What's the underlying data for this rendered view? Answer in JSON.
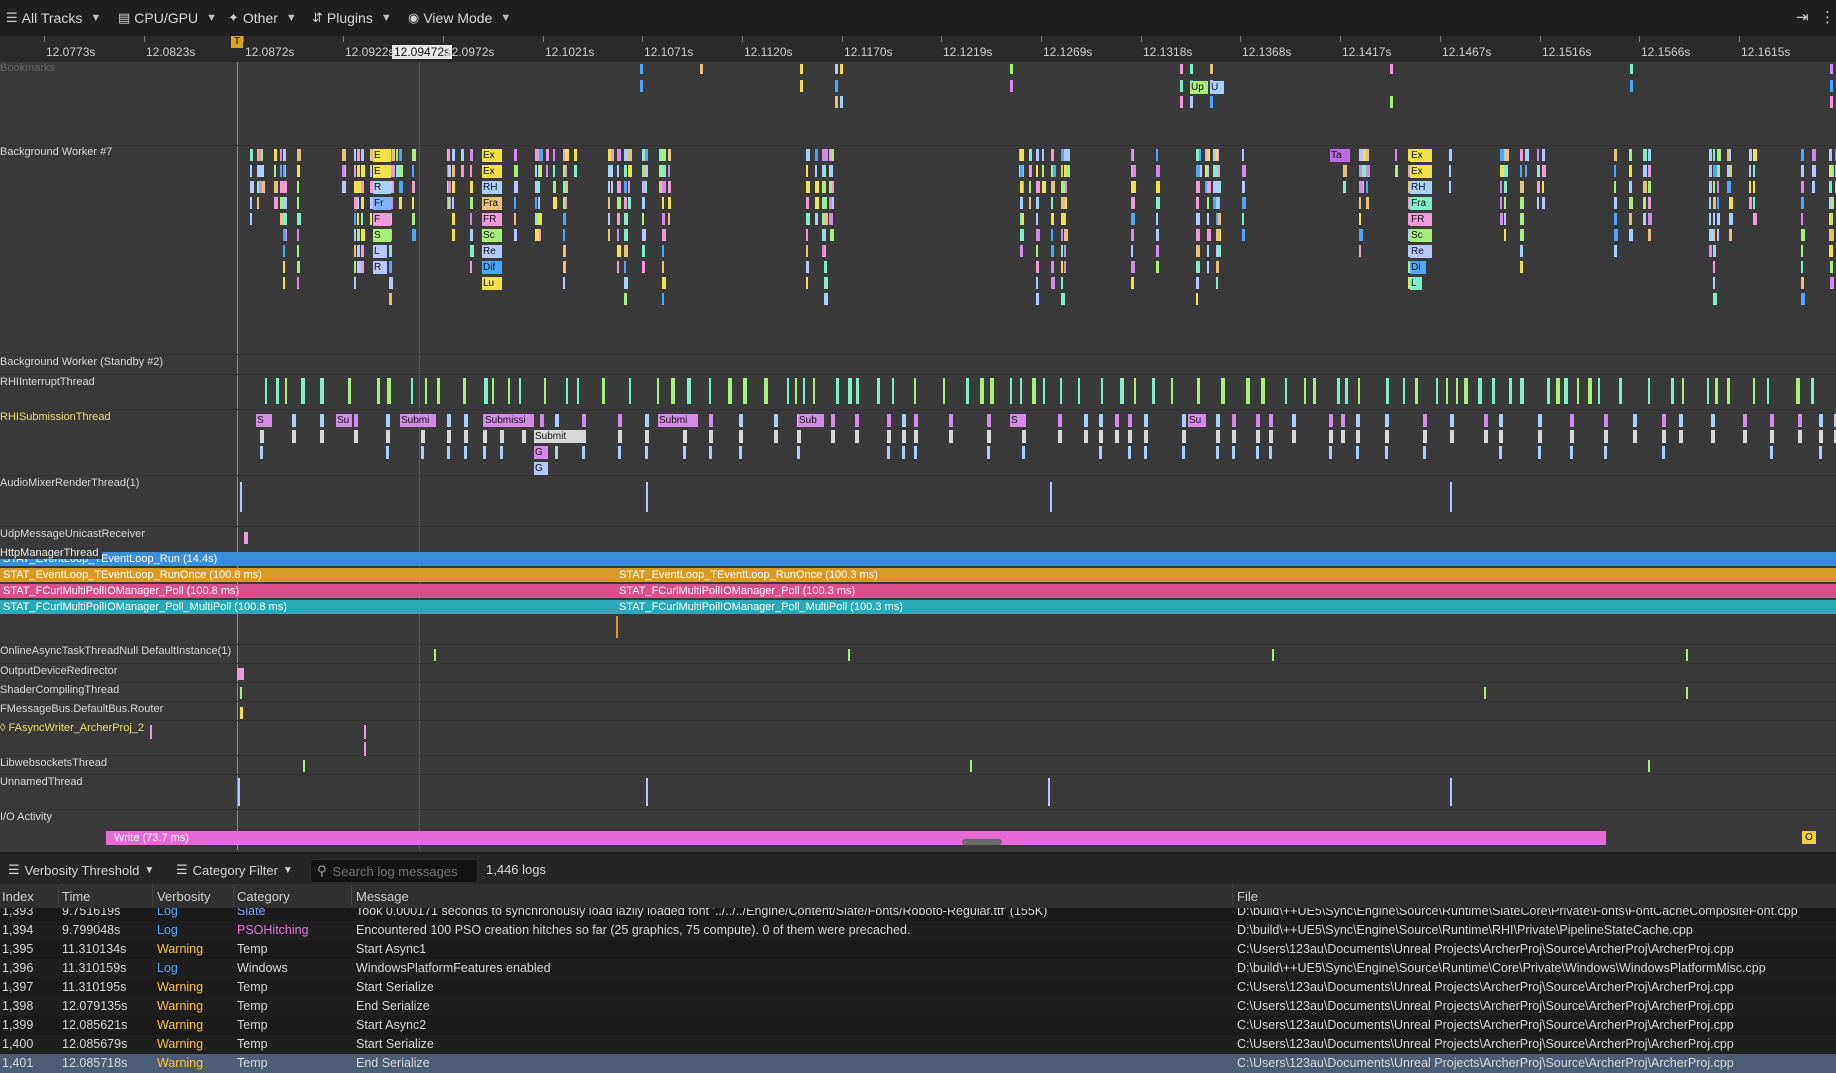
{
  "toolbar": {
    "all_tracks": "All Tracks",
    "cpu_gpu": "CPU/GPU",
    "other": "Other",
    "plugins": "Plugins",
    "view_mode": "View Mode"
  },
  "ruler": {
    "ticks": [
      "12.0773s",
      "12.0823s",
      "12.0872s",
      "12.0922s",
      "12.0972s",
      "12.1021s",
      "12.1071s",
      "12.1120s",
      "12.1170s",
      "12.1219s",
      "12.1269s",
      "12.1318s",
      "12.1368s",
      "12.1417s",
      "12.1467s",
      "12.1516s",
      "12.1566s",
      "12.1615s"
    ],
    "cursor_time": "12.09472s",
    "marker": "T"
  },
  "timeline": {
    "bookmarks_label": "Bookmarks",
    "tracks": [
      "Background Worker #7",
      "Background Worker (Standby #2)",
      "RHIInterruptThread",
      "RHISubmissionThread",
      "AudioMixerRenderThread(1)",
      "UdpMessageUnicastReceiver",
      "HttpManagerThread",
      "OnlineAsyncTaskThreadNull DefaultInstance(1)",
      "OutputDeviceRedirector",
      "ShaderCompilingThread",
      "FMessageBus.DefaultBus.Router",
      "◊ FAsyncWriter_ArcherProj_2",
      "LibwebsocketsThread",
      "UnnamedThread",
      "I/O Activity"
    ],
    "http_events": {
      "run": "STAT_EventLoop_TEventLoop_Run (14.4s)",
      "run_once_a": "STAT_EventLoop_TEventLoop_RunOnce (100.8 ms)",
      "run_once_b": "STAT_EventLoop_TEventLoop_RunOnce (100.3 ms)",
      "poll_a": "STAT_FCurlMultiPollIOManager_Poll (100.8 ms)",
      "poll_b": "STAT_FCurlMultiPollIOManager_Poll (100.3 ms)",
      "multipoll_a": "STAT_FCurlMultiPollIOManager_Poll_MultiPoll (100.8 ms)",
      "multipoll_b": "STAT_FCurlMultiPollIOManager_Poll_MultiPoll (100.3 ms)"
    },
    "io_write": "Write (73.7 ms)",
    "io_o": "O",
    "worker_boxes": [
      "Ex",
      "Ex",
      "RH",
      "Fra",
      "FR",
      "Sc",
      "Re",
      "Dif",
      "Lu"
    ],
    "worker_boxes_b": [
      "Ex",
      "Ex",
      "RH",
      "Fra",
      "FR",
      "Sc",
      "Re",
      "Di",
      "L"
    ],
    "worker_box_misc": [
      "E",
      "E",
      "R",
      "Fr",
      "F",
      "S",
      "L",
      "R"
    ],
    "worker_box_ta": "Ta",
    "top_boxes": [
      "Up",
      "U"
    ],
    "rhi_boxes": [
      "S",
      "Su",
      "Submi",
      "Submissi",
      "Submit",
      "Sub",
      "S",
      "Su",
      "Submi",
      "G",
      "G"
    ]
  },
  "logbar": {
    "verbosity": "Verbosity Threshold",
    "category": "Category Filter",
    "search_placeholder": "Search log messages",
    "count": "1,446 logs"
  },
  "log_columns": [
    "Index",
    "Time",
    "Verbosity",
    "Category",
    "Message",
    "File"
  ],
  "logs": [
    {
      "index": "1,393",
      "time": "9.751619s",
      "verbosity": "Log",
      "category": "Slate",
      "message": "Took 0.000171 seconds to synchronously load lazily loaded font '../../../Engine/Content/Slate/Fonts/Roboto-Regular.ttf' (155K)",
      "file": "D:\\build\\++UE5\\Sync\\Engine\\Source\\Runtime\\SlateCore\\Private\\Fonts\\FontCacheCompositeFont.cpp"
    },
    {
      "index": "1,394",
      "time": "9.799048s",
      "verbosity": "Log",
      "category": "PSOHitching",
      "message": "Encountered 100 PSO creation hitches so far (25 graphics, 75 compute). 0 of them were precached.",
      "file": "D:\\build\\++UE5\\Sync\\Engine\\Source\\Runtime\\RHI\\Private\\PipelineStateCache.cpp"
    },
    {
      "index": "1,395",
      "time": "11.310134s",
      "verbosity": "Warning",
      "category": "Temp",
      "message": "Start Async1",
      "file": "C:\\Users\\123au\\Documents\\Unreal Projects\\ArcherProj\\Source\\ArcherProj\\ArcherProj.cpp"
    },
    {
      "index": "1,396",
      "time": "11.310159s",
      "verbosity": "Log",
      "category": "Windows",
      "message": "WindowsPlatformFeatures enabled",
      "file": "D:\\build\\++UE5\\Sync\\Engine\\Source\\Runtime\\Core\\Private\\Windows\\WindowsPlatformMisc.cpp"
    },
    {
      "index": "1,397",
      "time": "11.310195s",
      "verbosity": "Warning",
      "category": "Temp",
      "message": "Start Serialize",
      "file": "C:\\Users\\123au\\Documents\\Unreal Projects\\ArcherProj\\Source\\ArcherProj\\ArcherProj.cpp"
    },
    {
      "index": "1,398",
      "time": "12.079135s",
      "verbosity": "Warning",
      "category": "Temp",
      "message": "End Serialize",
      "file": "C:\\Users\\123au\\Documents\\Unreal Projects\\ArcherProj\\Source\\ArcherProj\\ArcherProj.cpp"
    },
    {
      "index": "1,399",
      "time": "12.085621s",
      "verbosity": "Warning",
      "category": "Temp",
      "message": "Start Async2",
      "file": "C:\\Users\\123au\\Documents\\Unreal Projects\\ArcherProj\\Source\\ArcherProj\\ArcherProj.cpp"
    },
    {
      "index": "1,400",
      "time": "12.085679s",
      "verbosity": "Warning",
      "category": "Temp",
      "message": "Start Serialize",
      "file": "C:\\Users\\123au\\Documents\\Unreal Projects\\ArcherProj\\Source\\ArcherProj\\ArcherProj.cpp"
    },
    {
      "index": "1,401",
      "time": "12.085718s",
      "verbosity": "Warning",
      "category": "Temp",
      "message": "End Serialize",
      "file": "C:\\Users\\123au\\Documents\\Unreal Projects\\ArcherProj\\Source\\ArcherProj\\ArcherProj.cpp"
    }
  ],
  "colors": {
    "log": "#4fa7ff",
    "warning": "#ffc233",
    "selected_row": "#4d5d77",
    "http_run": "#3b8fd9",
    "http_runonce": "#d79a26",
    "http_poll": "#d9508a",
    "http_multipoll": "#2aa9b8",
    "io_write": "#e86ad6"
  }
}
